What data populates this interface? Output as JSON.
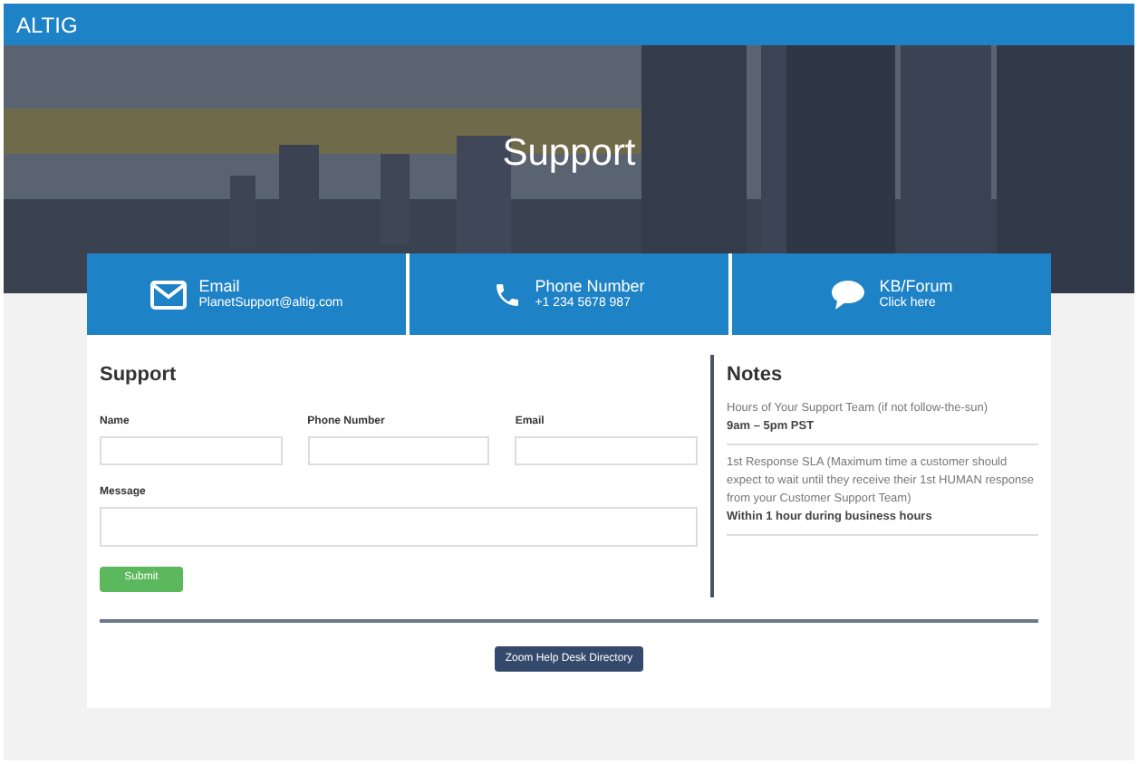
{
  "brand": "ALTIG",
  "hero": {
    "title": "Support",
    "kind": "picture"
  },
  "contacts": [
    {
      "kind": "email",
      "title": "Email",
      "detail": "PlanetSupport@altig.com"
    },
    {
      "kind": "phone",
      "title": "Phone Number",
      "detail": "+1 234 5678 987"
    },
    {
      "kind": "chat",
      "title": "KB/Forum",
      "detail": "Click here"
    }
  ],
  "form": {
    "title": "Support",
    "fields": [
      {
        "label": "Name"
      },
      {
        "label": "Phone Number"
      },
      {
        "label": "Email"
      }
    ],
    "message_label": "Message",
    "submit": "Submit"
  },
  "notes": {
    "title": "Notes",
    "items": [
      {
        "text": "Hours of Your Support Team (if not follow-the-sun)",
        "value": "9am – 5pm PST"
      },
      {
        "text": "1st Response SLA (Maximum time a customer should expect to wait until they receive their 1st HUMAN response from your Customer Support Team)",
        "value": "Within 1 hour during business hours"
      }
    ]
  },
  "directory_button": "Zoom Help Desk Directory"
}
